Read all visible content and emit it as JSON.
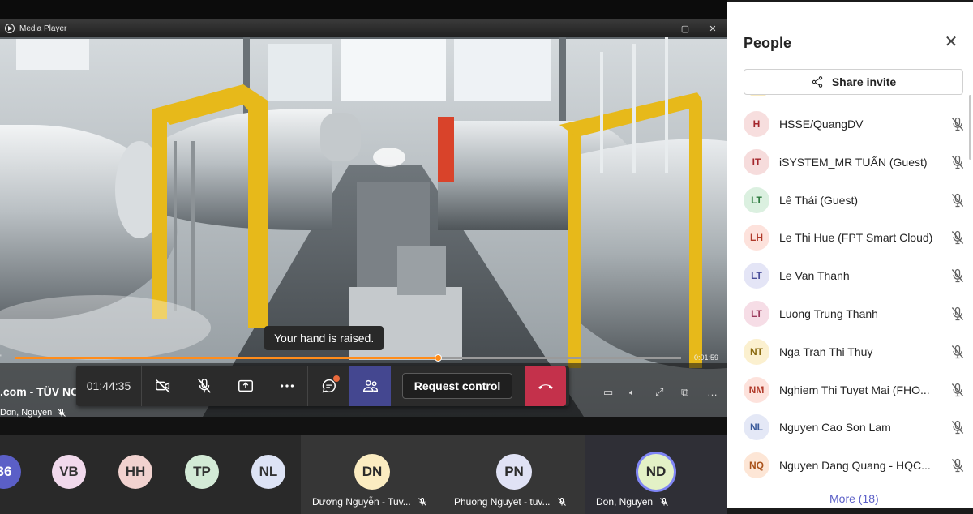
{
  "media_player": {
    "title": "Media Player",
    "time_total": "0:01:59",
    "progress": 0.635
  },
  "stage": {
    "title": ".com - TÜV NC",
    "presenter": "Don, Nguyen"
  },
  "toast": "Your hand is raised.",
  "controls": {
    "timer": "01:44:35",
    "request_control": "Request control",
    "icons": [
      "video-off-icon",
      "mic-off-icon",
      "share-tray-icon",
      "more-icon",
      "chat-icon",
      "people-icon",
      "hang-up-icon"
    ]
  },
  "gallery": {
    "small": [
      {
        "initials": "36",
        "color": "#5b5fc7"
      },
      {
        "initials": "VB",
        "color": "#f1d9ec"
      },
      {
        "initials": "HH",
        "color": "#f1d2cf"
      },
      {
        "initials": "TP",
        "color": "#d3ead6"
      },
      {
        "initials": "NL",
        "color": "#dde3f5"
      }
    ],
    "tiles": [
      {
        "initials": "DN",
        "name": "Dương Nguyễn - Tuv...",
        "color": "#fbecc1"
      },
      {
        "initials": "PN",
        "name": "Phuong Nguyet - tuv...",
        "color": "#e0e2f5"
      },
      {
        "initials": "ND",
        "name": "Don, Nguyen",
        "color": "#e3f1c6"
      }
    ]
  },
  "people": {
    "title": "People",
    "share_invite": "Share invite",
    "more": "More (18)",
    "participants": [
      {
        "initials": "H",
        "name": "HSSE/QuangDV",
        "bg": "#f7dede",
        "fg": "#a4262c"
      },
      {
        "initials": "IT",
        "name": "iSYSTEM_MR TUẤN (Guest)",
        "bg": "#f6dcdc",
        "fg": "#a4262c"
      },
      {
        "initials": "LT",
        "name": "Lê Thái (Guest)",
        "bg": "#dbf0e0",
        "fg": "#2d7a3e"
      },
      {
        "initials": "LH",
        "name": "Le Thi Hue (FPT Smart Cloud)",
        "bg": "#fde2dc",
        "fg": "#b03a2a"
      },
      {
        "initials": "LT",
        "name": "Le Van Thanh",
        "bg": "#e4e5f6",
        "fg": "#4a4f9a"
      },
      {
        "initials": "LT",
        "name": "Luong Trung Thanh",
        "bg": "#f6dde6",
        "fg": "#9a3a5c"
      },
      {
        "initials": "NT",
        "name": "Nga Tran Thi Thuy",
        "bg": "#fbf0cf",
        "fg": "#8a6a10"
      },
      {
        "initials": "NM",
        "name": "Nghiem Thi Tuyet Mai (FHO...",
        "bg": "#fde2dc",
        "fg": "#b03a2a"
      },
      {
        "initials": "NL",
        "name": "Nguyen Cao Son Lam",
        "bg": "#e4e8f6",
        "fg": "#3a5a9a"
      },
      {
        "initials": "NQ",
        "name": "Nguyen Dang Quang - HQC...",
        "bg": "#fde6d6",
        "fg": "#a9521a"
      }
    ]
  }
}
